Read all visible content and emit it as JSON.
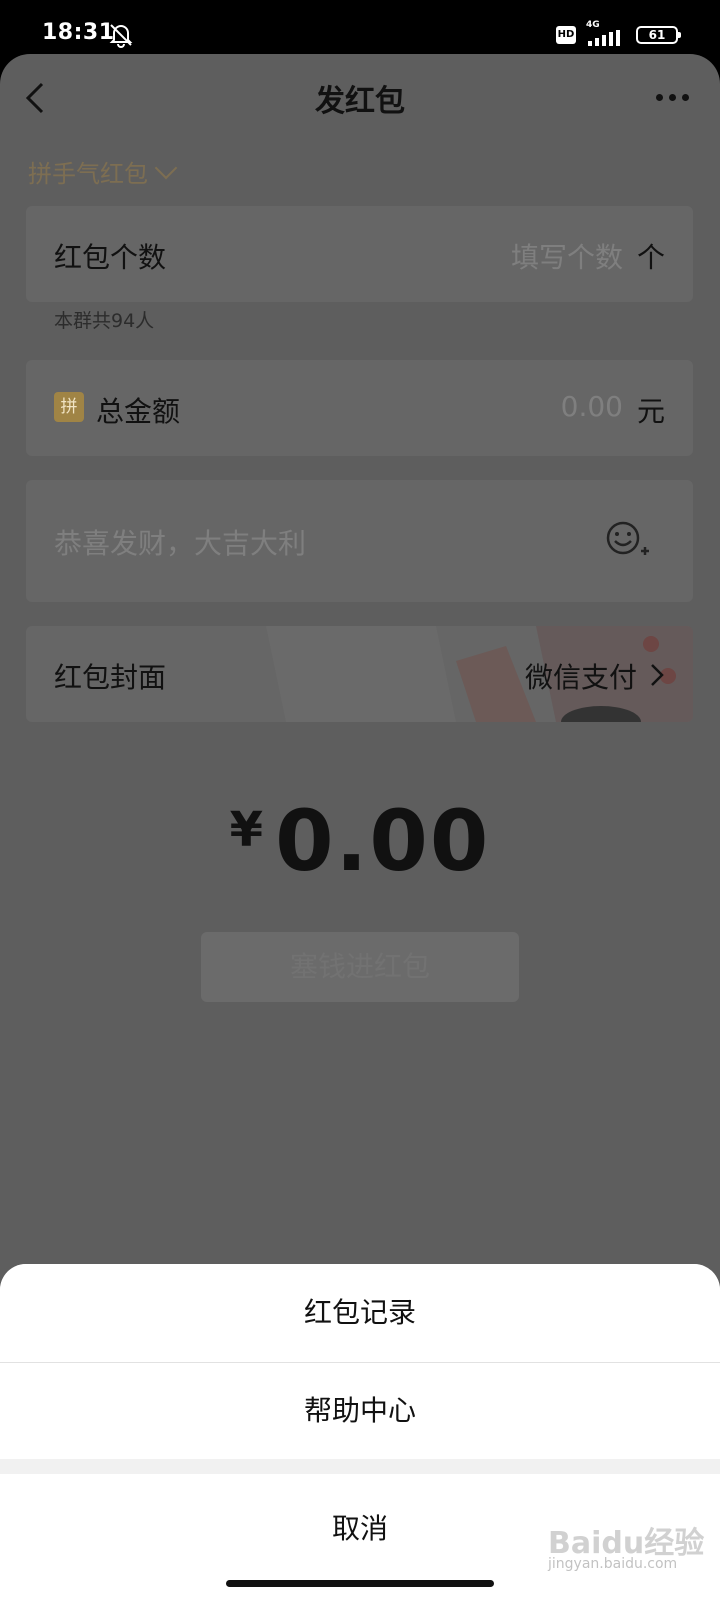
{
  "status_bar": {
    "time": "18:31",
    "hd": "HD",
    "network": "4G",
    "battery": "61"
  },
  "nav": {
    "title": "发红包"
  },
  "packet_type": "拼手气红包",
  "count_row": {
    "label": "红包个数",
    "placeholder": "填写个数",
    "unit": "个"
  },
  "group_hint": "本群共94人",
  "amount_row": {
    "badge": "拼",
    "label": "总金额",
    "value": "0.00",
    "unit": "元"
  },
  "greeting": {
    "placeholder": "恭喜发财，大吉大利"
  },
  "cover_row": {
    "label": "红包封面",
    "value": "微信支付"
  },
  "total": {
    "currency": "¥",
    "amount": "0.00"
  },
  "submit_label": "塞钱进红包",
  "action_sheet": {
    "items": [
      "红包记录",
      "帮助中心"
    ],
    "cancel": "取消"
  },
  "watermark": {
    "logo": "Baidu经验",
    "url": "jingyan.baidu.com"
  },
  "colors": {
    "overlay_page": "#5e5e5e",
    "accent_gold": "#a08445",
    "sheet_bg": "#ffffff"
  }
}
